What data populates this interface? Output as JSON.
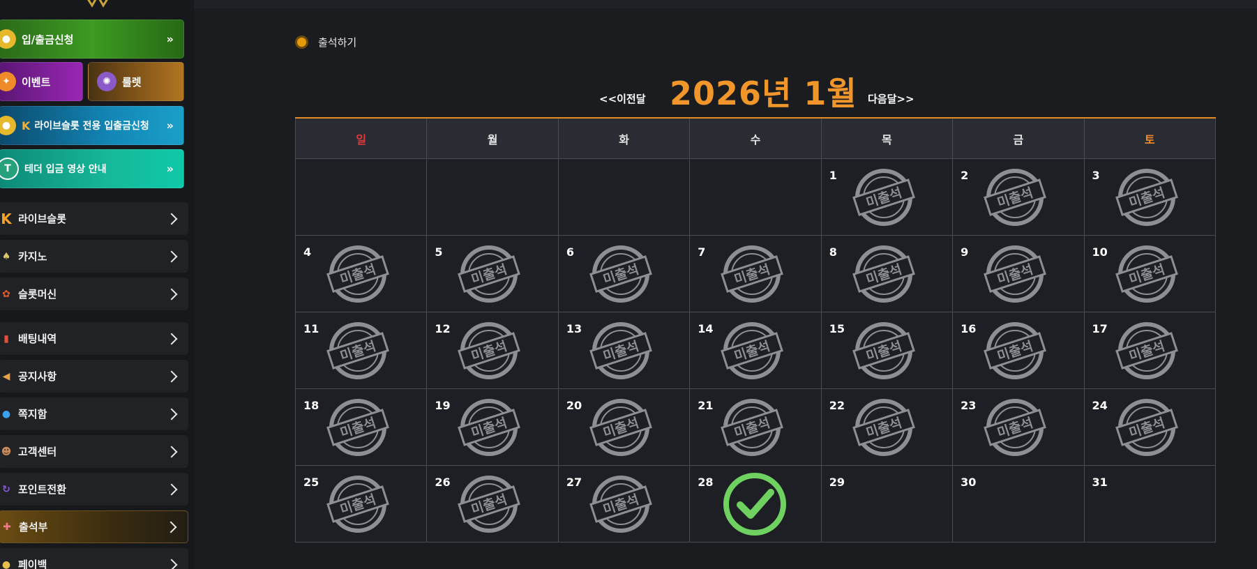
{
  "sidebar": {
    "buttons": {
      "deposit": "입/출금신청",
      "event": "이벤트",
      "roulette": "룰렛",
      "live_slot_deposit": "라이브슬롯 전용 입출금신청",
      "tether_guide": "테더 입금 영상 안내"
    },
    "menu": [
      {
        "label": "라이브슬롯",
        "icon": "k-logo-icon"
      },
      {
        "label": "카지노",
        "icon": "casino-icon"
      },
      {
        "label": "슬롯머신",
        "icon": "slot-icon"
      },
      {
        "label": "배팅내역",
        "icon": "clipboard-icon"
      },
      {
        "label": "공지사항",
        "icon": "megaphone-icon"
      },
      {
        "label": "쪽지함",
        "icon": "chat-icon"
      },
      {
        "label": "고객센터",
        "icon": "support-icon"
      },
      {
        "label": "포인트전환",
        "icon": "exchange-icon"
      },
      {
        "label": "출석부",
        "icon": "gift-icon",
        "active": true
      },
      {
        "label": "페이백",
        "icon": "coin-icon"
      }
    ]
  },
  "attendance": {
    "label": "출석하기",
    "prev": "<<이전달",
    "next": "다음달>>",
    "title": "2026년 1월",
    "weekdays": [
      "일",
      "월",
      "화",
      "수",
      "목",
      "금",
      "토"
    ],
    "stamp_text": "미출석",
    "days": [
      {
        "n": "",
        "s": ""
      },
      {
        "n": "",
        "s": ""
      },
      {
        "n": "",
        "s": ""
      },
      {
        "n": "",
        "s": ""
      },
      {
        "n": "1",
        "s": "absent"
      },
      {
        "n": "2",
        "s": "absent"
      },
      {
        "n": "3",
        "s": "absent"
      },
      {
        "n": "4",
        "s": "absent"
      },
      {
        "n": "5",
        "s": "absent"
      },
      {
        "n": "6",
        "s": "absent"
      },
      {
        "n": "7",
        "s": "absent"
      },
      {
        "n": "8",
        "s": "absent"
      },
      {
        "n": "9",
        "s": "absent"
      },
      {
        "n": "10",
        "s": "absent"
      },
      {
        "n": "11",
        "s": "absent"
      },
      {
        "n": "12",
        "s": "absent"
      },
      {
        "n": "13",
        "s": "absent"
      },
      {
        "n": "14",
        "s": "absent"
      },
      {
        "n": "15",
        "s": "absent"
      },
      {
        "n": "16",
        "s": "absent"
      },
      {
        "n": "17",
        "s": "absent"
      },
      {
        "n": "18",
        "s": "absent"
      },
      {
        "n": "19",
        "s": "absent"
      },
      {
        "n": "20",
        "s": "absent"
      },
      {
        "n": "21",
        "s": "absent"
      },
      {
        "n": "22",
        "s": "absent"
      },
      {
        "n": "23",
        "s": "absent"
      },
      {
        "n": "24",
        "s": "absent"
      },
      {
        "n": "25",
        "s": "absent"
      },
      {
        "n": "26",
        "s": "absent"
      },
      {
        "n": "27",
        "s": "absent"
      },
      {
        "n": "28",
        "s": "present"
      },
      {
        "n": "29",
        "s": ""
      },
      {
        "n": "30",
        "s": ""
      },
      {
        "n": "31",
        "s": ""
      }
    ]
  }
}
